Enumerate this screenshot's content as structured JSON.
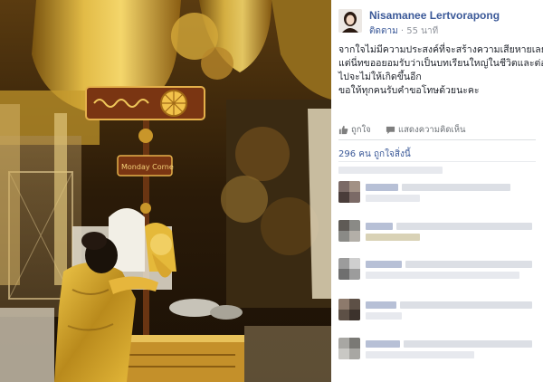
{
  "post": {
    "author": "Nisamanee Lertvorapong",
    "follow_label": "ติดตาม",
    "separator": "·",
    "time": "55 นาที",
    "text_lines": [
      "จากใจไม่มีความประสงค์ที่จะสร้างความเสียหายเลย",
      "แต่นี่ทขออยอมรับว่าเป็นบทเรียนใหญ่ในชีวิตและต่อ",
      "ไปจะไม่ให้เกิดขึ้นอีก",
      "ขอให้ทุกคนรับคำขอโทษด้วยนะคะ"
    ]
  },
  "actions": {
    "like_label": "ถูกใจ",
    "comment_label": "แสดงความคิดเห็น"
  },
  "likes": {
    "count": "296",
    "unit": "คน",
    "suffix": "ถูกใจสิ่งนี้"
  },
  "photo": {
    "sign_text": "Monday Corne"
  },
  "icons": {
    "like": "thumbs-up-icon",
    "comment": "speech-bubble-icon"
  },
  "colors": {
    "link_blue": "#3b5998",
    "meta_gray": "#90949c",
    "gold": "#c9a227",
    "sign_brown": "#7a3512"
  }
}
